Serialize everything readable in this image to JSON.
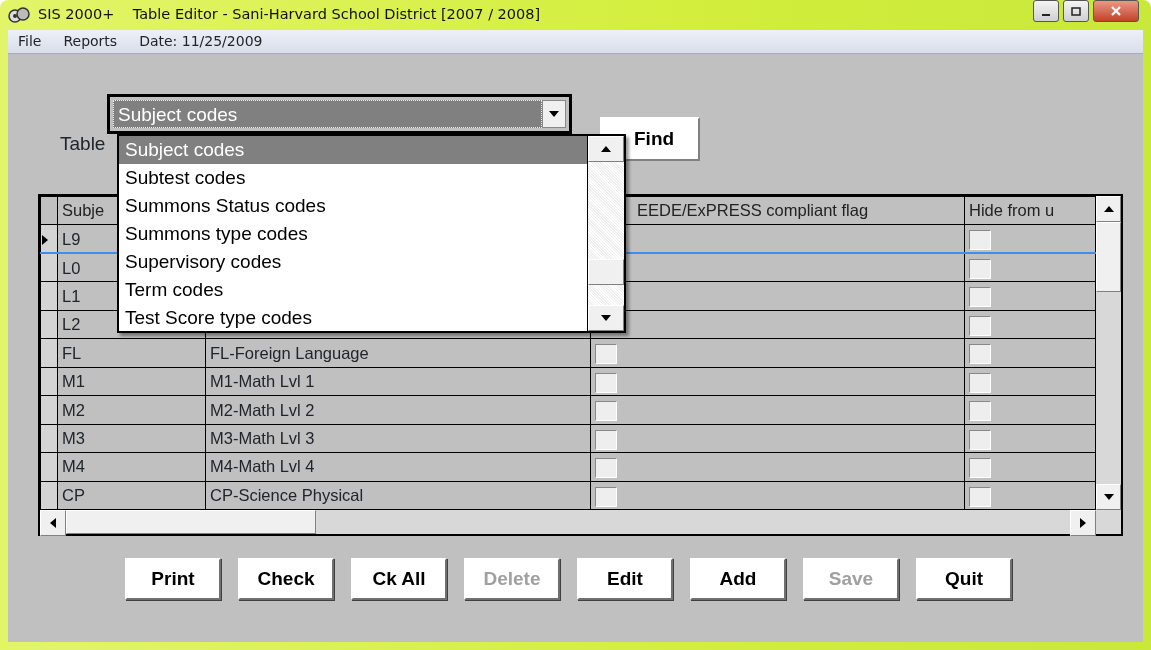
{
  "window": {
    "title": "SIS 2000+    Table Editor - Sani-Harvard School District [2007 / 2008]"
  },
  "menu": [
    {
      "label": "File"
    },
    {
      "label": "Reports"
    },
    {
      "label": "Date: 11/25/2009"
    }
  ],
  "table_label": {
    "text": "Table"
  },
  "table_select": {
    "value": "Subject codes",
    "expanded": true,
    "options": [
      {
        "label": "Subject codes",
        "selected": true
      },
      {
        "label": "Subtest codes",
        "selected": false
      },
      {
        "label": "Summons Status codes",
        "selected": false
      },
      {
        "label": "Summons type codes",
        "selected": false
      },
      {
        "label": "Supervisory codes",
        "selected": false
      },
      {
        "label": "Term codes",
        "selected": false
      },
      {
        "label": "Test Score type codes",
        "selected": false
      }
    ]
  },
  "find_button": {
    "label": "Find"
  },
  "grid": {
    "columns": [
      {
        "label": "Subje"
      },
      {},
      {
        "label": "EEDE/ExPRESS compliant flag"
      },
      {
        "label": "Hide from u"
      }
    ],
    "rows": [
      {
        "code": "L9",
        "selected": true,
        "hide": false
      },
      {
        "code": "L0",
        "selected": false,
        "hide": false
      },
      {
        "code": "L1",
        "selected": false,
        "hide": false
      },
      {
        "code": "L2",
        "selected": false,
        "hide": false
      },
      {
        "code": "FL",
        "description": "FL-Foreign Language",
        "compliant": false,
        "selected": false,
        "hide": false
      },
      {
        "code": "M1",
        "description": "M1-Math Lvl 1",
        "compliant": false,
        "selected": false,
        "hide": false
      },
      {
        "code": "M2",
        "description": "M2-Math Lvl 2",
        "compliant": false,
        "selected": false,
        "hide": false
      },
      {
        "code": "M3",
        "description": "M3-Math Lvl 3",
        "compliant": false,
        "selected": false,
        "hide": false
      },
      {
        "code": "M4",
        "description": "M4-Math Lvl 4",
        "compliant": false,
        "selected": false,
        "hide": false
      },
      {
        "code": "CP",
        "description": "CP-Science Physical",
        "compliant": false,
        "selected": false,
        "hide": false
      }
    ]
  },
  "buttons": [
    {
      "label": "Print",
      "disabled": false
    },
    {
      "label": "Check",
      "disabled": false
    },
    {
      "label": "Ck All",
      "disabled": false
    },
    {
      "label": "Delete",
      "disabled": true
    },
    {
      "label": "Edit",
      "disabled": false
    },
    {
      "label": "Add",
      "disabled": false
    },
    {
      "label": "Save",
      "disabled": true
    },
    {
      "label": "Quit",
      "disabled": false
    }
  ]
}
